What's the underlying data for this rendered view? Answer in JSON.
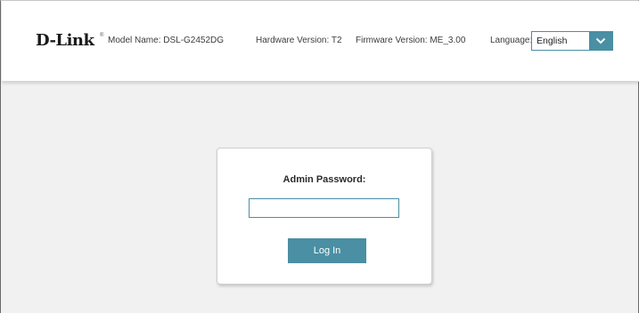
{
  "header": {
    "brand": "D-Link",
    "trademark": "®",
    "model_name": "Model Name: DSL-G2452DG",
    "hardware_version": "Hardware Version: T2",
    "firmware_version": "Firmware Version: ME_3.00",
    "language_label": "Language:",
    "language_selected": "English"
  },
  "login": {
    "password_label": "Admin Password:",
    "password_value": "",
    "login_button_label": "Log In"
  },
  "colors": {
    "accent": "#4a8fa3",
    "page_background": "#f1f1f1",
    "header_background": "#ffffff"
  },
  "icons": {
    "language_dropdown": "chevron-down-icon"
  }
}
